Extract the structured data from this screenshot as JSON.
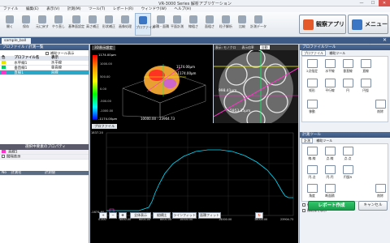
{
  "window": {
    "title": "VR-3000 Series 解析アプリケーション"
  },
  "menu": [
    "ファイル",
    "編集(E)",
    "表示(V)",
    "計測(M)",
    "ツール(T)",
    "レポート(R)",
    "ウィンドウ(W)",
    "ヘルプ(H)"
  ],
  "ribbon": {
    "buttons": [
      "開く",
      "保存",
      "元に戻す",
      "やり直し",
      "基準面設定",
      "高さ補正",
      "形状補正",
      "画像処理",
      "プロファイル",
      "体積・面積",
      "平面計測",
      "線粗さ",
      "面粗さ",
      "粒子解析",
      "比較",
      "計測データ"
    ],
    "active": "プロファイル",
    "big_buttons": [
      "観察アプリへ",
      "メニューへ"
    ]
  },
  "doc_tab": {
    "label": "sample_ball"
  },
  "left_panel": {
    "header": "プロファイル / 計測一覧",
    "checkbox_label": "補助ツール表示",
    "table_headers": [
      "色",
      "プロファイル名",
      "表示"
    ],
    "rows": [
      {
        "color": "#e6e600",
        "name": "水平線1",
        "mode": "水平線"
      },
      {
        "color": "#00cc66",
        "name": "垂直線1",
        "mode": "垂直線"
      },
      {
        "color": "#ff33cc",
        "name": "直線1",
        "mode": "直線"
      }
    ],
    "prop_header": "選択中要素のプロパティ",
    "props": [
      {
        "color": "#ff33cc",
        "label": "直線1"
      },
      {
        "color": "#ffffff",
        "label": "間隔表示"
      }
    ],
    "meas_headers": [
      "No",
      "計測名",
      "計測値"
    ]
  },
  "view3d": {
    "tab": "3D表示設定",
    "scale_max": "1174.00μm",
    "scale_min": "-1174.00μm",
    "scale_ticks": [
      "1000.00",
      "500.00",
      "0.00",
      "-500.00",
      "-1000.00"
    ],
    "z_top": "1174.00μm",
    "z_bottom": "-1174.00μm",
    "xy_label": "10000.00 : 23904.73"
  },
  "viewimg": {
    "toolbar": [
      "表示: モノクロ",
      "表示倍率",
      "自動"
    ],
    "annot1": "998.41μm",
    "annot2": "5953.35μm"
  },
  "graph": {
    "tab": "プロファイル",
    "y_max": "1837.20",
    "y_min": "-1674.60",
    "x_labels": [
      "0.000",
      "4000.00",
      "6000.00",
      "8000.00",
      "10000.00",
      "14000.00",
      "18000.00",
      "23904.73"
    ]
  },
  "graph_toolbar": [
    "全体表示",
    "縦横比",
    "ラインフィット",
    "面積フィット"
  ],
  "right_panel": {
    "header": "プロファイルツール",
    "tabs": [
      "プロファイル",
      "補助ツール"
    ],
    "tools_top": [
      "2点指定",
      "水平線",
      "垂直線",
      "直線",
      "矩形",
      "平行線",
      "円",
      "円弧",
      "移動",
      "削除"
    ],
    "header2": "計測ツール",
    "tabs2": [
      "計測",
      "補助ツール"
    ],
    "tools_bottom": [
      "線-線",
      "点-線",
      "点-点",
      "円-点",
      "円-円",
      "円弧R",
      "角度",
      "断面積",
      "削除"
    ],
    "checkboxes": [
      "任意の点で計測",
      "補助線を表示"
    ],
    "report_button": "レポート作成",
    "cancel_button": "キャンセル"
  }
}
